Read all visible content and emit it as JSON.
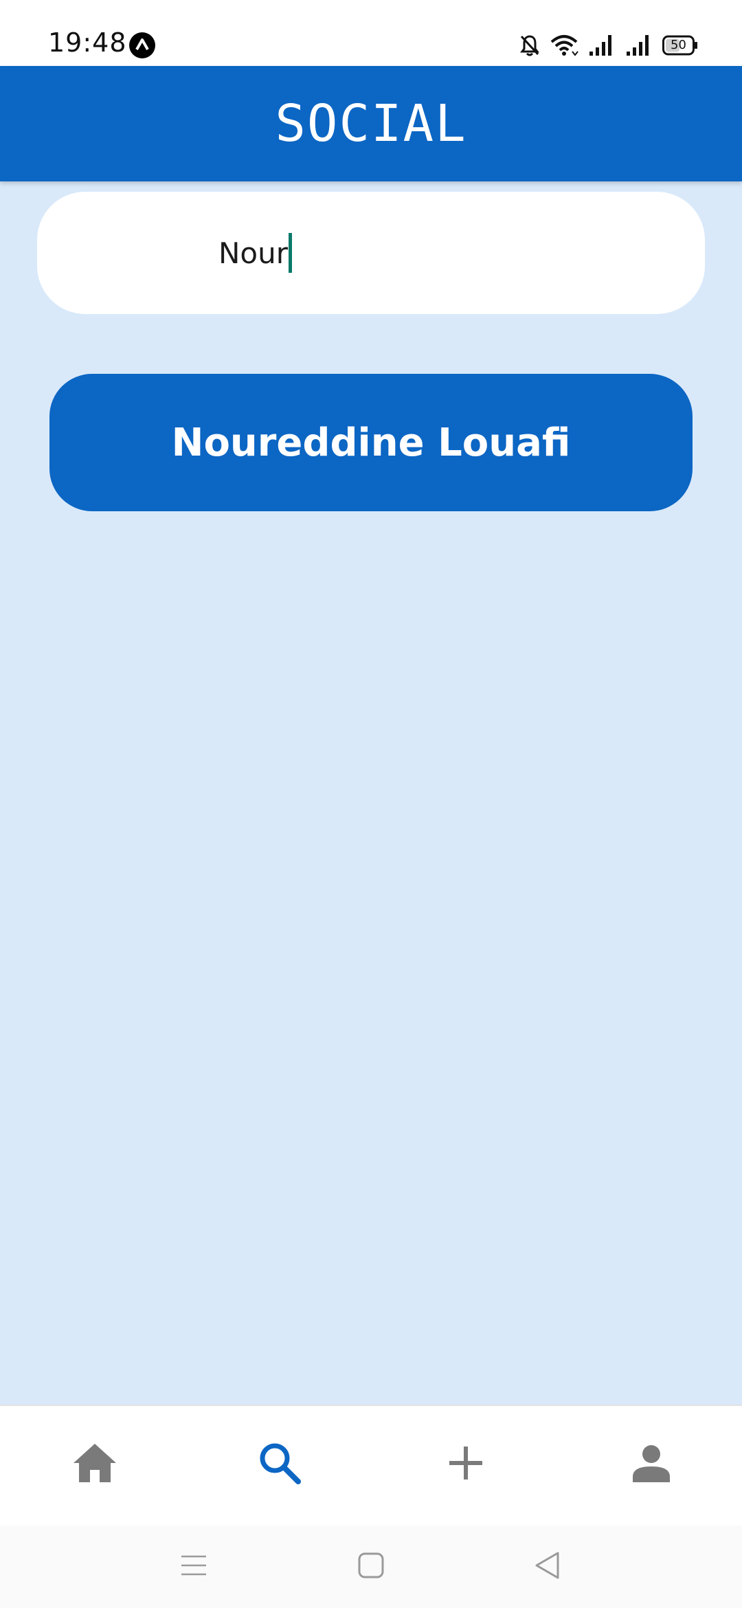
{
  "status_bar": {
    "time": "19:48",
    "battery": "50",
    "icons": [
      "app-notification-icon",
      "bell-off-icon",
      "wifi-icon",
      "signal-icon",
      "signal-icon",
      "battery-icon"
    ]
  },
  "header": {
    "title": "SOCIAL"
  },
  "search": {
    "value": "Nour"
  },
  "results": [
    {
      "label": "Noureddine Louafi"
    }
  ],
  "bottom_nav": {
    "items": [
      {
        "icon": "home-icon",
        "active": false
      },
      {
        "icon": "search-icon",
        "active": true
      },
      {
        "icon": "plus-icon",
        "active": false
      },
      {
        "icon": "profile-icon",
        "active": false
      }
    ],
    "active_color": "#0c66c4",
    "inactive_color": "#7a7a7a"
  },
  "system_nav": {
    "icons": [
      "menu-icon",
      "home-square-icon",
      "back-icon"
    ]
  },
  "colors": {
    "primary": "#0c66c4",
    "background": "#d9e9fa",
    "caret": "#0a7a6a"
  }
}
